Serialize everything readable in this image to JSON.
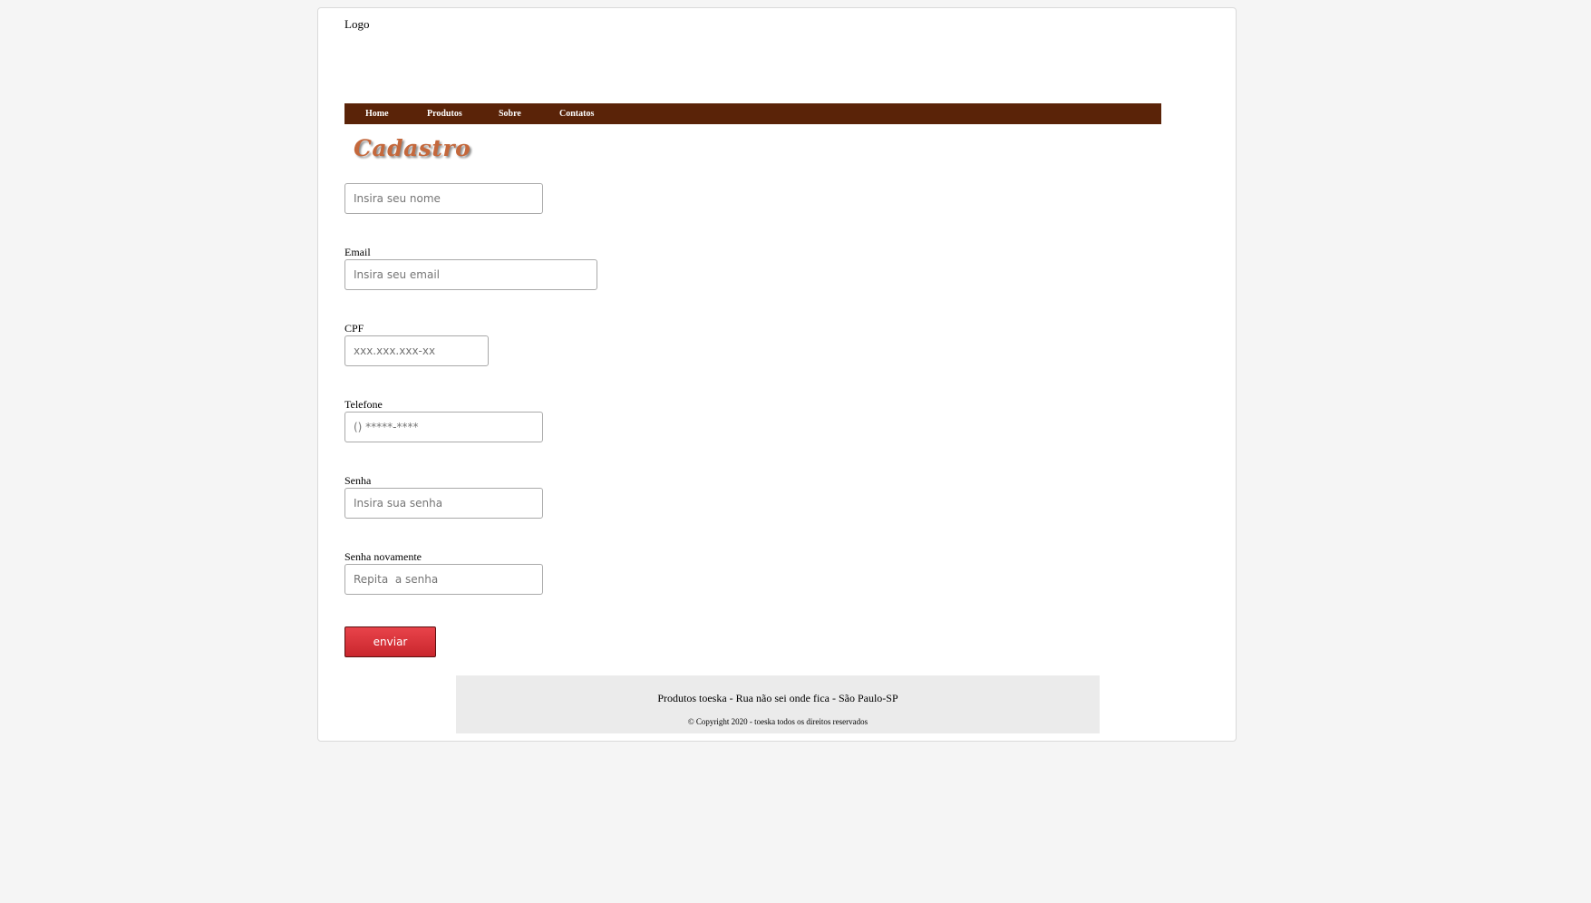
{
  "header": {
    "logo": "Logo"
  },
  "nav": {
    "items": [
      {
        "label": "Home"
      },
      {
        "label": "Produtos"
      },
      {
        "label": "Sobre"
      },
      {
        "label": "Contatos"
      }
    ],
    "background": "#5a2308"
  },
  "page": {
    "title": "Cadastro",
    "title_color": "#c4683c"
  },
  "form": {
    "nome": {
      "placeholder": "Insira seu nome"
    },
    "email": {
      "label": "Email",
      "placeholder": "Insira seu email"
    },
    "cpf": {
      "label": "CPF",
      "placeholder": "xxx.xxx.xxx-xx"
    },
    "telefone": {
      "label": "Telefone",
      "placeholder": "() *****-****"
    },
    "senha": {
      "label": "Senha",
      "placeholder": "Insira sua senha"
    },
    "senha_novamente": {
      "label": "Senha novamente",
      "placeholder": "Repita  a senha"
    },
    "submit_label": "enviar",
    "submit_color": "#d8323a"
  },
  "footer": {
    "address": "Produtos toeska - Rua não sei onde fica - São Paulo-SP",
    "copyright": "© Copyright 2020 - toeska todos os direitos reservados"
  }
}
